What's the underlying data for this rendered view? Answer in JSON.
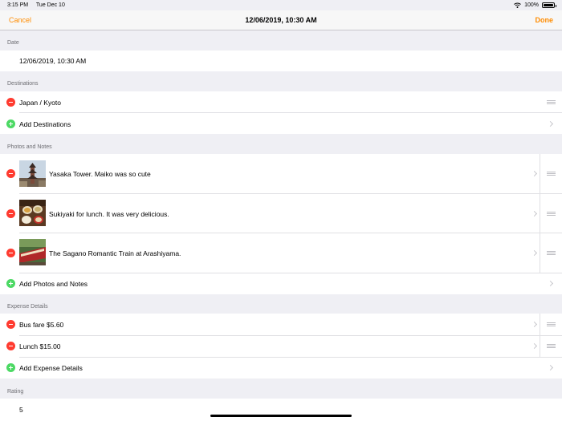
{
  "status_bar": {
    "time": "3:15 PM",
    "date": "Tue Dec 10",
    "battery": "100%"
  },
  "nav": {
    "cancel": "Cancel",
    "title": "12/06/2019, 10:30 AM",
    "done": "Done"
  },
  "colors": {
    "accent": "#ff8c00",
    "delete": "#ff3b30",
    "add": "#4cd964"
  },
  "date_section": {
    "header": "Date",
    "value": "12/06/2019, 10:30 AM"
  },
  "destinations": {
    "header": "Destinations",
    "items": [
      {
        "label": "Japan / Kyoto"
      }
    ],
    "add_label": "Add Destinations"
  },
  "photos": {
    "header": "Photos and Notes",
    "items": [
      {
        "label": "Yasaka Tower. Maiko was so cute",
        "thumb": "pagoda-photo"
      },
      {
        "label": "Sukiyaki for lunch. It was very delicious.",
        "thumb": "food-photo"
      },
      {
        "label": "The Sagano Romantic Train at Arashiyama.",
        "thumb": "train-photo"
      }
    ],
    "add_label": "Add Photos and Notes"
  },
  "expenses": {
    "header": "Expense Details",
    "items": [
      {
        "label": "Bus fare $5.60"
      },
      {
        "label": "Lunch $15.00"
      }
    ],
    "add_label": "Add Expense Details"
  },
  "rating": {
    "header": "Rating",
    "value": "5"
  }
}
